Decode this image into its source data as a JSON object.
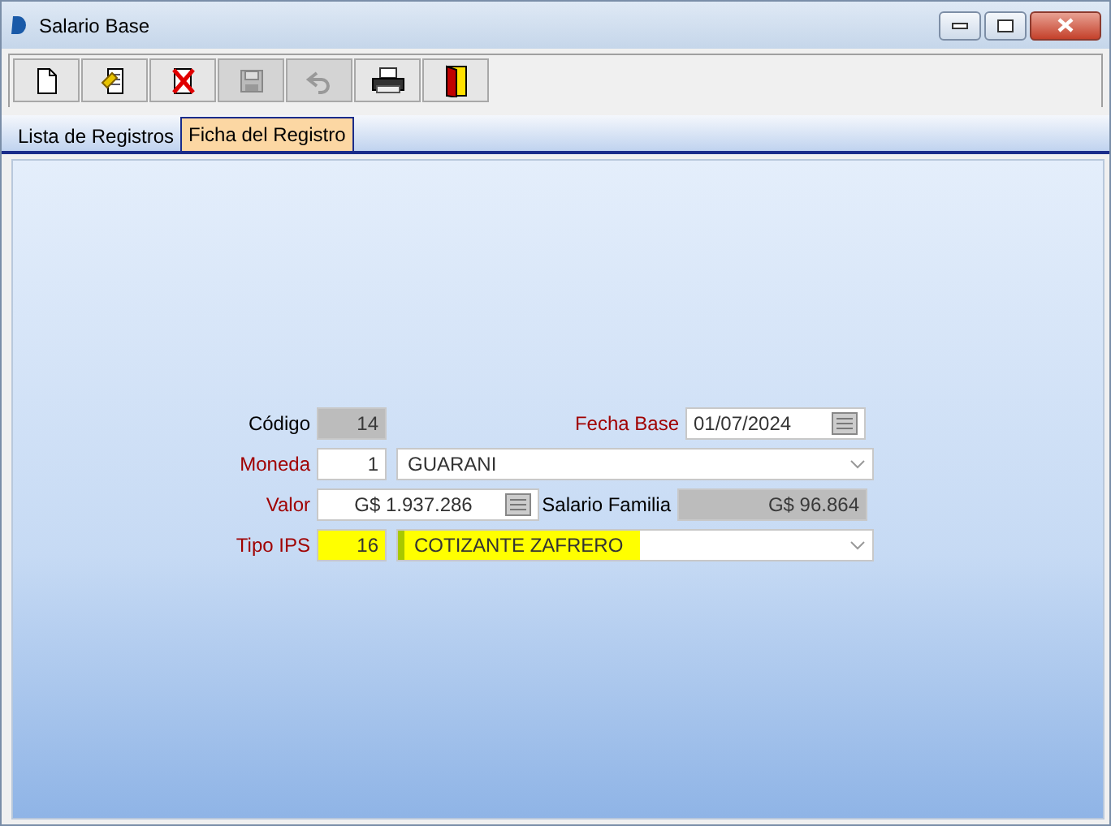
{
  "window": {
    "title": "Salario Base"
  },
  "toolbar": [
    {
      "kind": "new",
      "disabled": false
    },
    {
      "kind": "edit",
      "disabled": false
    },
    {
      "kind": "delete",
      "disabled": false
    },
    {
      "kind": "save",
      "disabled": true
    },
    {
      "kind": "undo",
      "disabled": true
    },
    {
      "kind": "print",
      "disabled": false
    },
    {
      "kind": "exit",
      "disabled": false
    }
  ],
  "tabs": [
    {
      "label": "Lista de Registros",
      "selected": false
    },
    {
      "label": "Ficha del Registro",
      "selected": true
    }
  ],
  "form": {
    "codigo": {
      "label": "Código",
      "required": false,
      "value": "14",
      "disabled": true
    },
    "fecha_base": {
      "label": "Fecha Base",
      "required": true,
      "value": "01/07/2024"
    },
    "moneda": {
      "label": "Moneda",
      "required": true,
      "code": "1",
      "value": "GUARANI",
      "highlighted": false
    },
    "valor": {
      "label": "Valor",
      "required": true,
      "value": "G$ 1.937.286"
    },
    "salario_familia": {
      "label": "Salario Familia",
      "required": false,
      "value": "G$ 96.864",
      "disabled": true
    },
    "tipo_ips": {
      "label": "Tipo IPS",
      "required": true,
      "code": "16",
      "value": "COTIZANTE ZAFRERO",
      "highlighted": true
    }
  }
}
